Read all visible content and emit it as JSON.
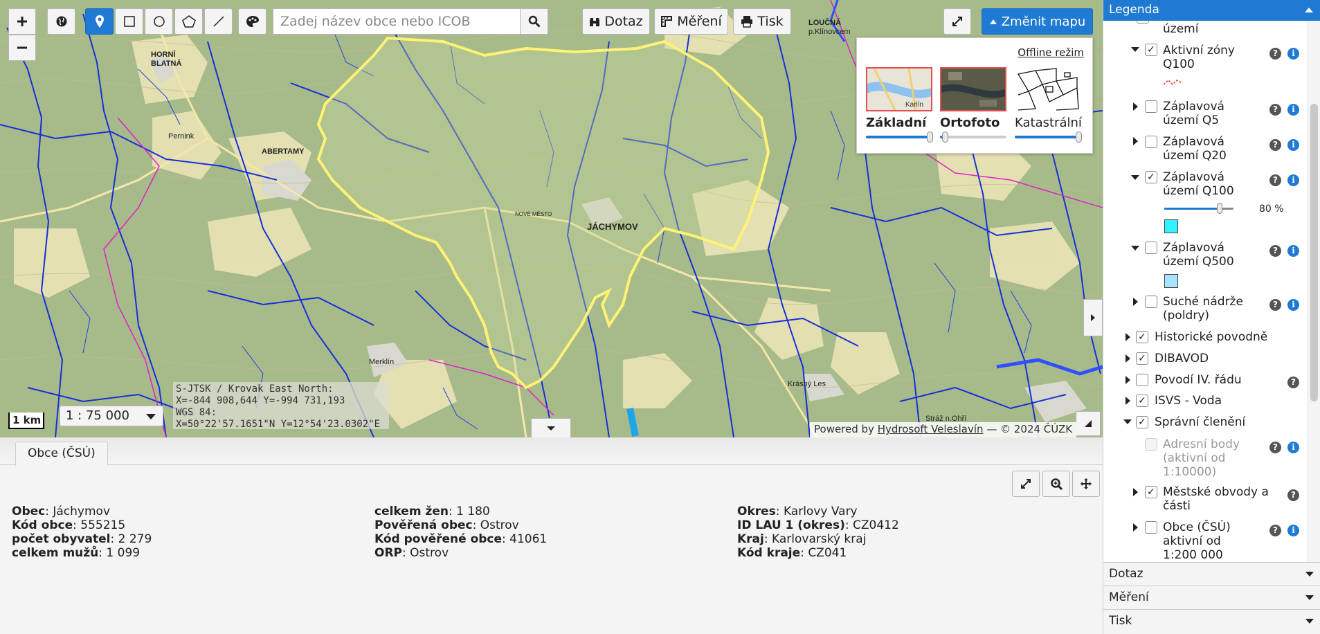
{
  "toolbar": {
    "search_placeholder": "Zadej název obce nebo ICOB",
    "query_label": "Dotaz",
    "measure_label": "Měření",
    "print_label": "Tisk",
    "change_map_label": "Změnit mapu"
  },
  "basemap_panel": {
    "offline_label": "Offline režim",
    "layers": [
      {
        "name": "Základní",
        "opacity": 1.0
      },
      {
        "name": "Ortofoto",
        "opacity": 0.05
      },
      {
        "name": "Katastrální",
        "opacity": 1.0
      }
    ]
  },
  "map": {
    "coords": {
      "line1": "S-JTSK / Krovak East North:",
      "line2": "X=-844 908,644 Y=-994 731,193",
      "line3": "WGS 84:",
      "line4": "X=50°22'57.1651\"N Y=12°54'23.0302\"E"
    },
    "scale_bar": "1 km",
    "scale_select": "1 : 75 000",
    "attribution_prefix": "Powered by",
    "attribution_link": "Hydrosoft Veleslavín",
    "attribution_suffix": "— © 2024 ČÚZK",
    "labels": [
      "HORNÍ BLATNÁ",
      "ABERTAMY",
      "Pernink",
      "JÁCHYMOV",
      "LOUČNÁ p.Klínovcem",
      "Merklín",
      "Krásný Les",
      "NOVÉ MĚSTO",
      "Stráž n.Ohří"
    ]
  },
  "bottom": {
    "tab": "Obce (ČSÚ)",
    "col1": [
      {
        "k": "Obec",
        "v": "Jáchymov"
      },
      {
        "k": "Kód obce",
        "v": "555215"
      },
      {
        "k": "počet obyvatel",
        "v": "2 279"
      },
      {
        "k": "celkem mužů",
        "v": "1 099"
      }
    ],
    "col2": [
      {
        "k": "celkem žen",
        "v": "1 180"
      },
      {
        "k": "Pověřená obec",
        "v": "Ostrov"
      },
      {
        "k": "Kód pověřené obce",
        "v": "41061"
      },
      {
        "k": "ORP",
        "v": "Ostrov"
      }
    ],
    "col3": [
      {
        "k": "Okres",
        "v": "Karlovy Vary"
      },
      {
        "k": "ID LAU 1 (okres)",
        "v": "CZ0412"
      },
      {
        "k": "Kraj",
        "v": "Karlovarský kraj"
      },
      {
        "k": "Kód kraje",
        "v": "CZ041"
      }
    ]
  },
  "legend": {
    "title": "Legenda",
    "items": {
      "uzemi_tail": "území",
      "aktivni_1": "Aktivní zóny",
      "aktivni_2": "Q100",
      "q5_1": "Záplavová",
      "q5_2": "území Q5",
      "q20_1": "Záplavová",
      "q20_2": "území Q20",
      "q100_1": "Záplavová",
      "q100_2": "území Q100",
      "q100_opacity": "80 %",
      "q500_1": "Záplavová",
      "q500_2": "území Q500",
      "suche_1": "Suché nádrže",
      "suche_2": "(poldry)",
      "historicke": "Historické povodně",
      "dibavod": "DIBAVOD",
      "povodi": "Povodí IV. řádu",
      "isvs": "ISVS - Voda",
      "spravni": "Správní členění",
      "adresni_1": "Adresní body",
      "adresni_2": "(aktivní od",
      "adresni_3": "1:10000)",
      "mestske_1": "Městské obvody a",
      "mestske_2": "části",
      "obce_1": "Obce (ČSÚ)",
      "obce_2": "aktivní od",
      "obce_3": "1:200 000"
    },
    "q100_opacity_value": 0.8,
    "colors": {
      "q100": "#33f0ff",
      "q500": "#a8e4ff",
      "accent": "#1e7ad2"
    }
  },
  "accordion": {
    "query": "Dotaz",
    "measure": "Měření",
    "print": "Tisk"
  }
}
